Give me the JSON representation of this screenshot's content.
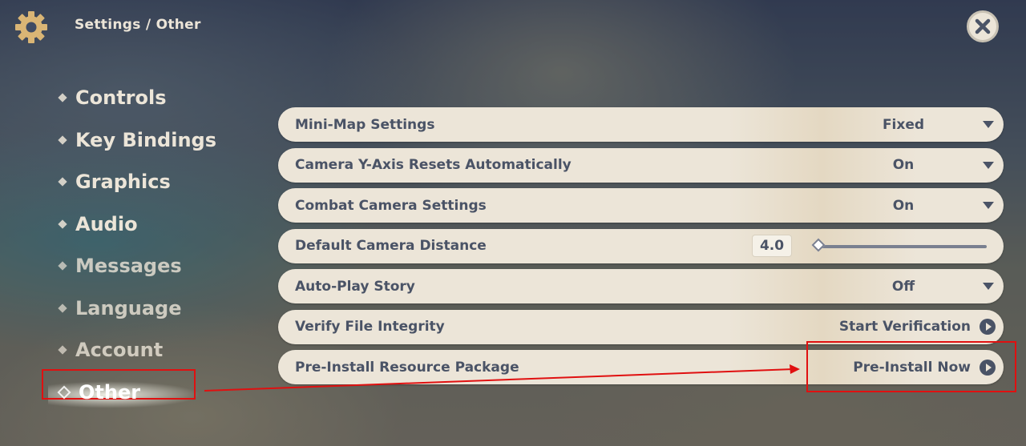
{
  "header": {
    "title": "Settings / Other",
    "icon": "gear-icon",
    "close_icon": "close-icon"
  },
  "sidebar": {
    "items": [
      {
        "label": "Controls",
        "active": false
      },
      {
        "label": "Key Bindings",
        "active": false
      },
      {
        "label": "Graphics",
        "active": false
      },
      {
        "label": "Audio",
        "active": false
      },
      {
        "label": "Messages",
        "active": false
      },
      {
        "label": "Language",
        "active": false
      },
      {
        "label": "Account",
        "active": false
      },
      {
        "label": "Other",
        "active": true
      }
    ]
  },
  "settings": {
    "rows": [
      {
        "label": "Mini-Map Settings",
        "value": "Fixed",
        "kind": "dropdown"
      },
      {
        "label": "Camera Y-Axis Resets Automatically",
        "value": "On",
        "kind": "dropdown"
      },
      {
        "label": "Combat Camera Settings",
        "value": "On",
        "kind": "dropdown"
      },
      {
        "label": "Default Camera Distance",
        "value": "4.0",
        "kind": "slider",
        "slider_fraction": 0.0
      },
      {
        "label": "Auto-Play Story",
        "value": "Off",
        "kind": "dropdown"
      },
      {
        "label": "Verify File Integrity",
        "value": "Start Verification",
        "kind": "action"
      },
      {
        "label": "Pre-Install Resource Package",
        "value": "Pre-Install Now",
        "kind": "action"
      }
    ]
  },
  "colors": {
    "panel": "#ece5d8",
    "text_dark": "#4a5366",
    "annotation": "#e01010"
  }
}
